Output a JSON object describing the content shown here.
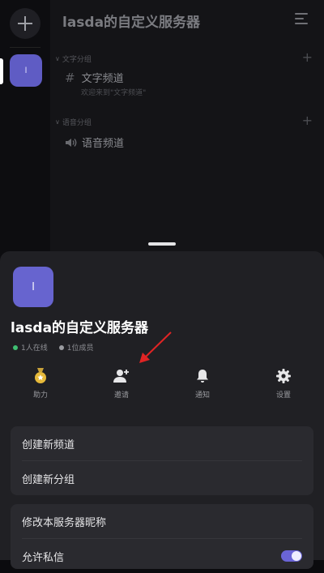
{
  "server": {
    "name": "lasda的自定义服务器",
    "icon_letter": "l",
    "accent": "#6764cf"
  },
  "channels": {
    "text_group_label": "文字分组",
    "text_channel_name": "文字频道",
    "text_channel_desc": "欢迎来到\"文字频道\"",
    "voice_group_label": "语音分组",
    "voice_channel_name": "语音频道"
  },
  "sheet": {
    "title": "lasda的自定义服务器",
    "online": "1人在线",
    "online_color": "#3fbf72",
    "members": "1位成员",
    "members_color": "#9a9ba0",
    "actions": [
      {
        "label": "助力",
        "icon": "boost-medal-icon"
      },
      {
        "label": "邀请",
        "icon": "invite-user-icon"
      },
      {
        "label": "通知",
        "icon": "bell-icon"
      },
      {
        "label": "设置",
        "icon": "gear-icon"
      }
    ],
    "card1": [
      "创建新频道",
      "创建新分组"
    ],
    "card2": [
      "修改本服务器昵称",
      "允许私信"
    ]
  }
}
